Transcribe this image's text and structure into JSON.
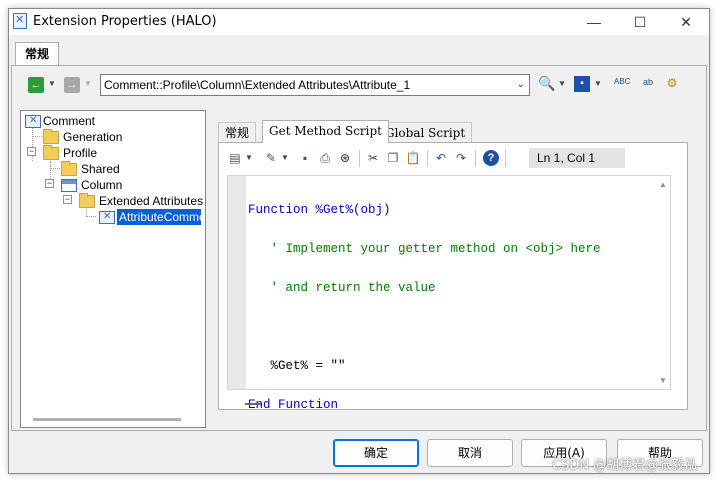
{
  "window": {
    "title": "Extension Properties (HALO)",
    "minimize": "—",
    "maximize": "☐",
    "close": "✕"
  },
  "outer_tabs": [
    {
      "label": "常规"
    }
  ],
  "toolbar": {
    "path": "Comment::Profile\\Column\\Extended Attributes\\Attribute_1"
  },
  "tree": [
    {
      "label": "Comment",
      "icon": "model-icon"
    },
    {
      "label": "Generation",
      "icon": "folder-icon"
    },
    {
      "label": "Profile",
      "icon": "folder-icon"
    },
    {
      "label": "Shared",
      "icon": "folder-icon"
    },
    {
      "label": "Column",
      "icon": "table-icon"
    },
    {
      "label": "Extended Attributes",
      "icon": "folder-icon"
    },
    {
      "label": "AttributeComment",
      "icon": "attribute-icon",
      "selected": true
    }
  ],
  "inner_tabs": [
    {
      "label": "常规"
    },
    {
      "label": "Get Method Script",
      "active": true
    },
    {
      "label": "Global Script"
    }
  ],
  "editor": {
    "cursor": "Ln 1, Col 1",
    "lines": [
      {
        "a": "Function",
        "b": " %Get%(obj)"
      },
      {
        "c": "   ' Implement your getter method on <obj> here"
      },
      {
        "c": "   ' and return the value"
      },
      {
        "b": ""
      },
      {
        "b": "   %Get% = \"\""
      },
      {
        "a": "End Function",
        "b": ""
      }
    ]
  },
  "buttons": {
    "ok": "确定",
    "cancel": "取消",
    "apply": "应用(A)",
    "help": "帮助"
  },
  "watermark": "CSDN @胡博君@张毅泓"
}
